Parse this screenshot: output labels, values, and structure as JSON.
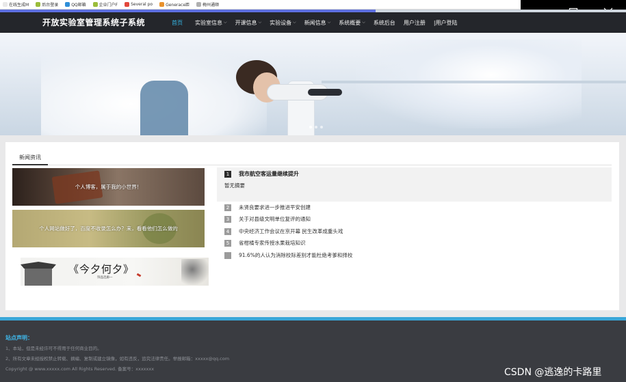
{
  "bookmarks": [
    {
      "label": "在线生成M",
      "color": "#e8e8e8"
    },
    {
      "label": "后台登录",
      "color": "#9bbd3b"
    },
    {
      "label": "QQ邮箱",
      "color": "#2f8fd8"
    },
    {
      "label": "企业门户F",
      "color": "#9bbd3b"
    },
    {
      "label": "Several po",
      "color": "#e2483c"
    },
    {
      "label": "Generace距",
      "color": "#e8922e"
    },
    {
      "label": "梅州通顺",
      "color": "#b0b0b0"
    }
  ],
  "nav": {
    "site_title": "开放实验室管理系统子系统",
    "items": [
      {
        "label": "首页",
        "dropdown": false
      },
      {
        "label": "实验室信息",
        "dropdown": true
      },
      {
        "label": "开课信息",
        "dropdown": true
      },
      {
        "label": "实验设备",
        "dropdown": true
      },
      {
        "label": "新闻信息",
        "dropdown": true
      },
      {
        "label": "系统概要",
        "dropdown": true
      },
      {
        "label": "系统后台",
        "dropdown": false
      },
      {
        "label": "用户注册",
        "dropdown": false
      },
      {
        "label": "|用户登陆",
        "dropdown": false
      }
    ]
  },
  "panel": {
    "tab_label": "新闻资讯",
    "promos": [
      "个人博客，属于我的小世界！",
      "个人网站做好了，百度不收录怎么办？来，看看他们怎么做的"
    ],
    "calligraphy": {
      "title": "《今夕何夕》",
      "subtitle": "饰品连廊一"
    },
    "featured": {
      "rank": "1",
      "title": "我市航空客运量继续提升",
      "summary": "暂无摘要"
    },
    "news": [
      {
        "rank": "2",
        "title": "未贤良要求进一步推进平安创建"
      },
      {
        "rank": "3",
        "title": "关于对县级文明单位复评的通知"
      },
      {
        "rank": "4",
        "title": "中央经济工作会议在京开幕 民生改革成重头戏"
      },
      {
        "rank": "5",
        "title": "省柑橘专家传授水果栽培知识"
      },
      {
        "rank": "",
        "title": "91.6%的人认为消除校际差别才能杜绝考爹和择校"
      }
    ]
  },
  "footer": {
    "title": "站点声明：",
    "lines": [
      "1、本站，但是未经许可不得用于任何商业目的。",
      "2、所有文章未经授权禁止转载、摘编、复制或建立镜像，如有违反，追究法律责任。举报邮箱：xxxxx@qq.com",
      "Copyright @ www.xxxxx.com All Rights Reserved. 备案号：xxxxxxx"
    ]
  },
  "watermark": "CSDN @逃逸的卡路里"
}
